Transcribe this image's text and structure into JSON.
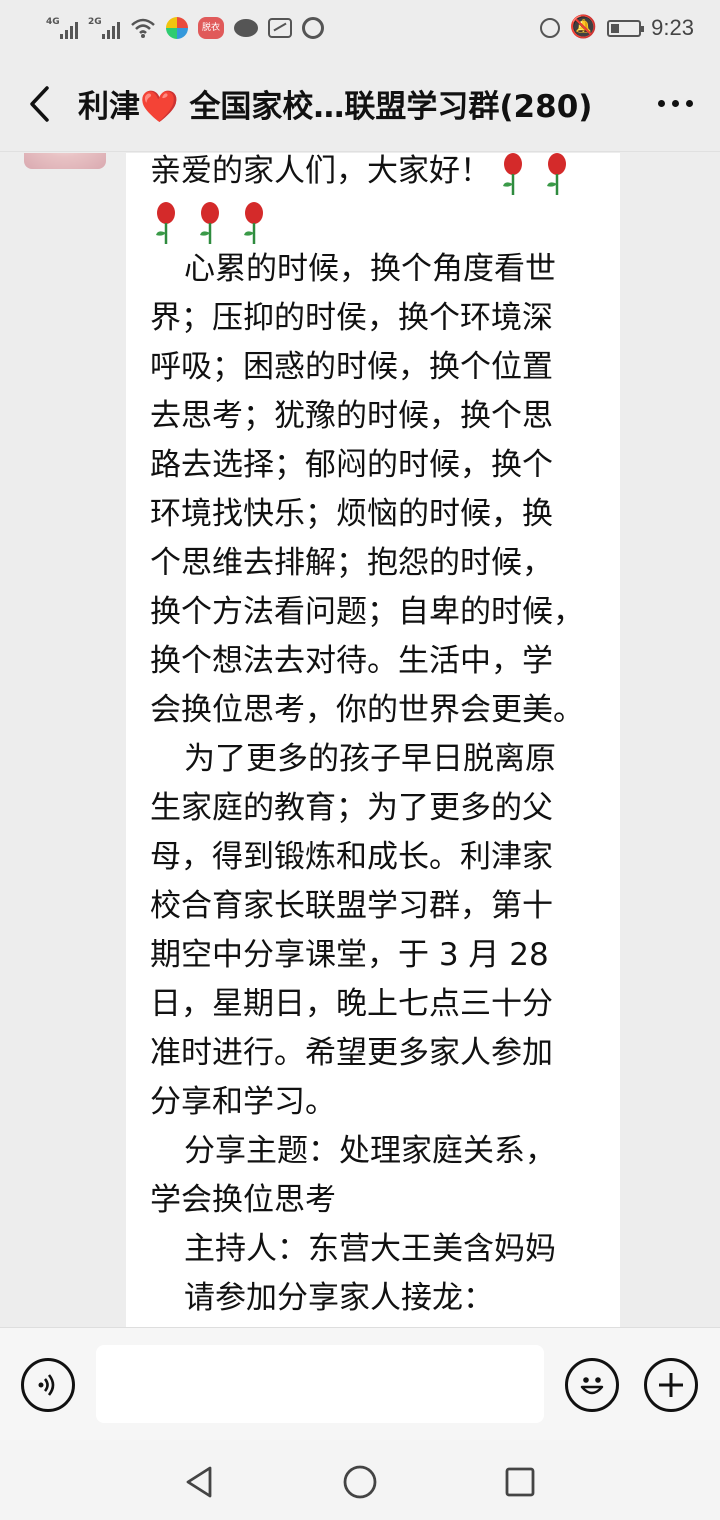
{
  "status_bar": {
    "signal_1": "4G",
    "signal_2": "2G",
    "app_badge": "脱衣",
    "time": "9:23",
    "battery_level": 0.3,
    "icons": [
      "signal-4g-icon",
      "signal-2g-icon",
      "wifi-icon",
      "app-icon",
      "app-badge-icon",
      "wechat-icon",
      "gallery-icon",
      "browser-icon",
      "alarm-icon",
      "mute-icon",
      "battery-icon"
    ]
  },
  "header": {
    "title": "利津❤️ 全国家校…联盟学习群(280)",
    "back_icon": "chevron-left-icon",
    "more_icon": "more-dots-icon"
  },
  "message": {
    "greeting": "亲爱的家人们，大家好！",
    "lines": [
      "心累的时候，换个角度看世",
      "界；压抑的时侯，换个环境深",
      "呼吸；困惑的时候，换个位置",
      "去思考；犹豫的时候，换个思",
      "路去选择；郁闷的时候，换个",
      "环境找快乐；烦恼的时候，换",
      "个思维去排解；抱怨的时候，",
      "换个方法看问题；自卑的时候，",
      "换个想法去对待。生活中，学",
      "会换位思考，你的世界会更美。",
      "为了更多的孩子早日脱离原",
      "生家庭的教育；为了更多的父",
      "母，得到锻炼和成长。利津家",
      "校合育家长联盟学习群，第十",
      "期空中分享课堂，于 3 月 28",
      "日，星期日，晚上七点三十分",
      "准时进行。希望更多家人参加",
      "分享和学习。",
      "分享主题：处理家庭关系，",
      "学会换位思考",
      "主持人：东营大王美含妈妈",
      "请参加分享家人接龙："
    ]
  },
  "input_bar": {
    "voice_icon": "voice-icon",
    "emoji_icon": "emoji-icon",
    "plus_icon": "plus-icon",
    "text_value": ""
  },
  "system_nav": {
    "back_icon": "triangle-back-icon",
    "home_icon": "circle-home-icon",
    "recent_icon": "square-recent-icon"
  }
}
